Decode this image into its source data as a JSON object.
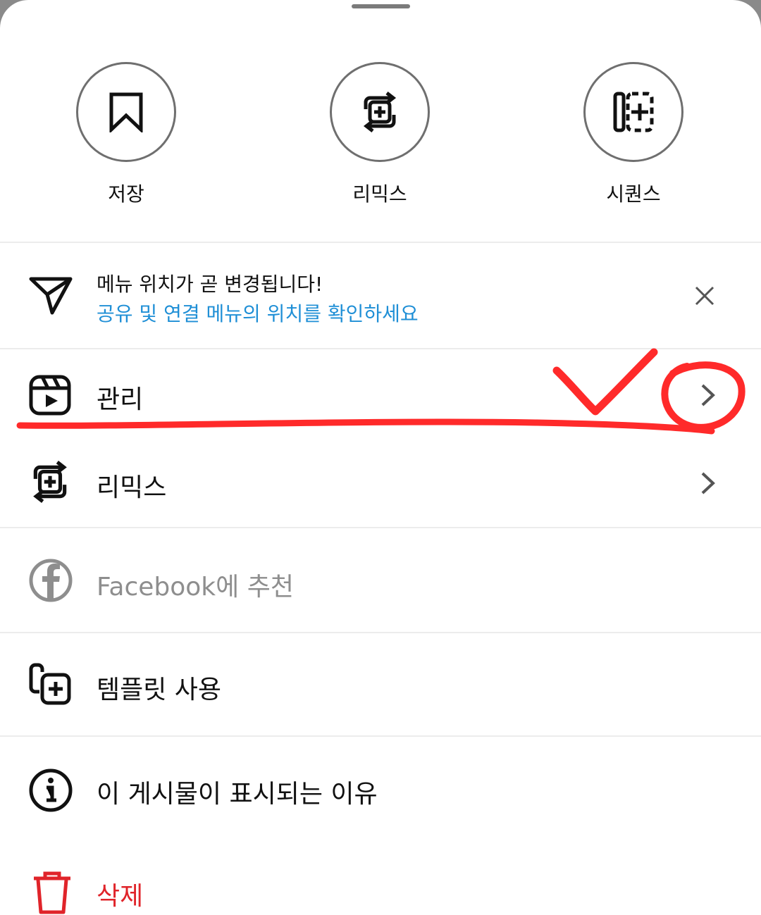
{
  "actions": [
    {
      "label": "저장",
      "icon": "bookmark-icon"
    },
    {
      "label": "리믹스",
      "icon": "remix-icon"
    },
    {
      "label": "시퀀스",
      "icon": "sequence-icon"
    }
  ],
  "notice": {
    "title": "메뉴 위치가 곧 변경됩니다!",
    "subtitle": "공유 및 연결 메뉴의 위치를 확인하세요",
    "icon": "send-icon",
    "subtitle_color": "#1f8fd6"
  },
  "menu": [
    {
      "label": "관리",
      "icon": "reels-icon",
      "chevron": true
    },
    {
      "label": "리믹스",
      "icon": "remix-icon",
      "chevron": true
    },
    {
      "label": "Facebook에 추천",
      "icon": "facebook-icon",
      "disabled": true
    },
    {
      "label": "템플릿 사용",
      "icon": "template-icon"
    },
    {
      "label": "이 게시물이 표시되는 이유",
      "icon": "info-icon"
    },
    {
      "label": "삭제",
      "icon": "trash-icon",
      "danger": true
    }
  ],
  "colors": {
    "danger": "#e0242a",
    "disabled": "#8e8e8e",
    "annotation": "#ff2a2a"
  }
}
